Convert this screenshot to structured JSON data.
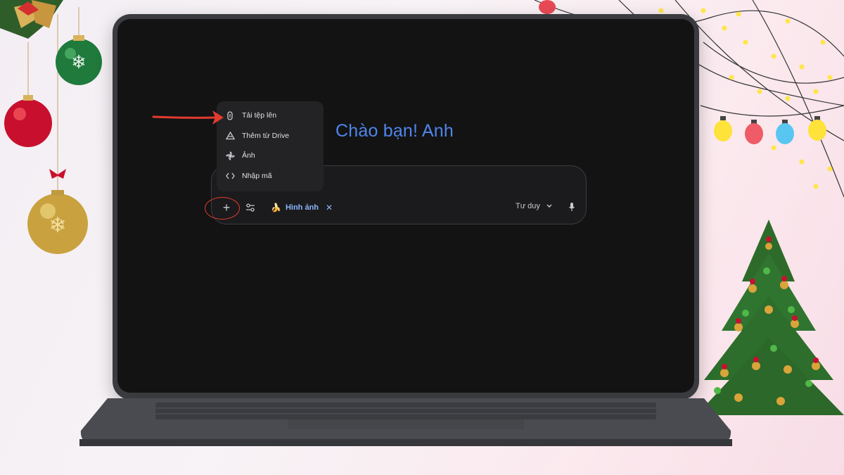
{
  "greeting": "Chào bạn! Anh",
  "attach_menu": {
    "items": [
      {
        "label": "Tải tệp lên",
        "icon": "paperclip-icon"
      },
      {
        "label": "Thêm từ Drive",
        "icon": "drive-icon"
      },
      {
        "label": "Ảnh",
        "icon": "photos-pinwheel-icon"
      },
      {
        "label": "Nhập mã",
        "icon": "code-icon"
      }
    ]
  },
  "prompt_bar": {
    "add_label": "+",
    "tools_icon": "tune-sliders-icon",
    "chip": {
      "emoji": "🍌",
      "label": "Hình ảnh",
      "close": "✕"
    },
    "mode": {
      "label": "Tư duy",
      "icon": "chevron-down-icon"
    },
    "mic_icon": "microphone-icon"
  },
  "annotations": {
    "arrow_color": "#e23b2e",
    "circle_color": "#e23b2e"
  },
  "colors": {
    "accent_blue": "#4f86ec",
    "chip_blue": "#8ab4f8",
    "screen_bg": "#131314"
  }
}
